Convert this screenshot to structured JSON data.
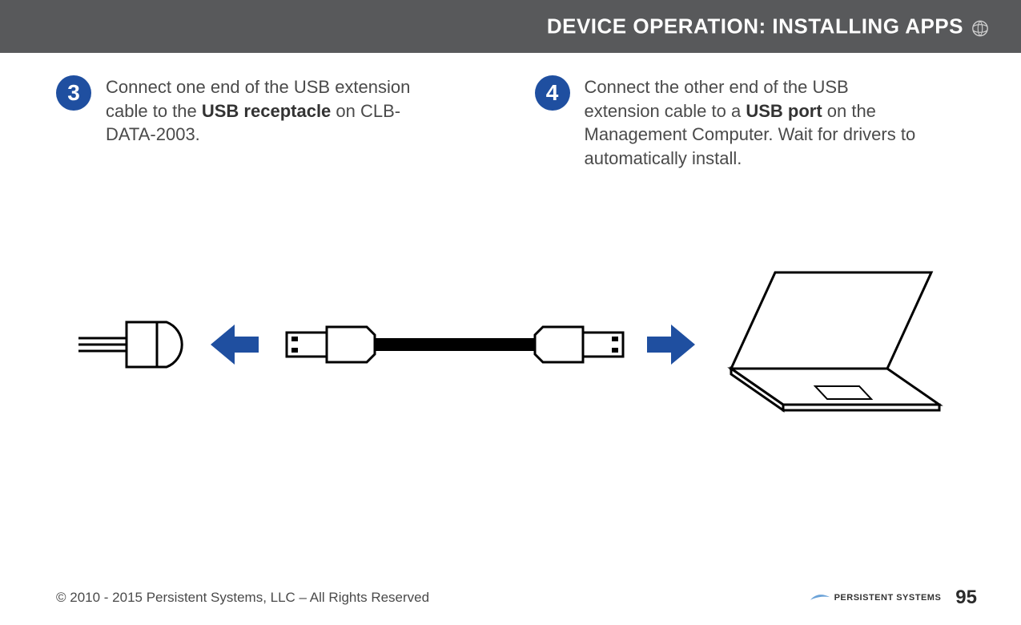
{
  "header": {
    "title": "DEVICE OPERATION:  INSTALLING APPS"
  },
  "steps": {
    "s3": {
      "num": "3",
      "pre": "Connect one end of the USB extension cable to the ",
      "bold": "USB receptacle",
      "post": " on CLB-DATA-2003."
    },
    "s4": {
      "num": "4",
      "pre": "Connect the other end of the USB extension cable to a ",
      "bold": "USB port",
      "post": " on the Management Computer.  Wait for drivers to automatically install."
    }
  },
  "footer": {
    "copyright": "© 2010 - 2015 Persistent Systems, LLC – All Rights Reserved",
    "brand": "PERSISTENT SYSTEMS",
    "page": "95"
  },
  "colors": {
    "badge": "#1f4fa0",
    "arrow": "#1f4fa0",
    "header_bg": "#58595b"
  }
}
